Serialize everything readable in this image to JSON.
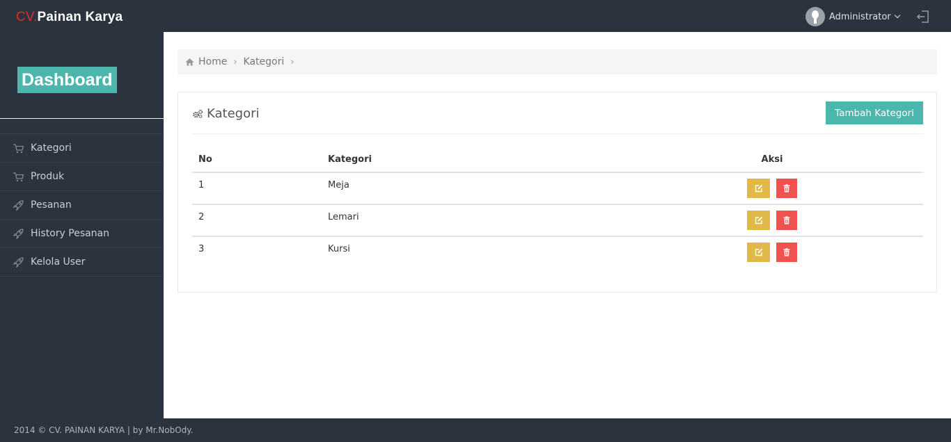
{
  "topbar": {
    "brand_prefix": "CV.",
    "brand_name": "Painan Karya",
    "user_name": "Administrator"
  },
  "sidebar": {
    "dashboard_label": "Dashboard",
    "items": [
      {
        "label": "Kategori",
        "icon": "cart-icon"
      },
      {
        "label": "Produk",
        "icon": "cart-icon"
      },
      {
        "label": "Pesanan",
        "icon": "rocket-icon"
      },
      {
        "label": "History Pesanan",
        "icon": "rocket-icon"
      },
      {
        "label": "Kelola User",
        "icon": "rocket-icon"
      }
    ]
  },
  "breadcrumb": {
    "home": "Home",
    "current": "Kategori"
  },
  "panel": {
    "title": "Kategori",
    "add_button": "Tambah Kategori",
    "columns": [
      "No",
      "Kategori",
      "Aksi"
    ],
    "rows": [
      {
        "no": "1",
        "kategori": "Meja"
      },
      {
        "no": "2",
        "kategori": "Lemari"
      },
      {
        "no": "3",
        "kategori": "Kursi"
      }
    ]
  },
  "footer": {
    "text": "2014 © CV. PAINAN KARYA | by Mr.NobOdy."
  },
  "colors": {
    "navbar": "#2b333e",
    "accent": "#4db6ac",
    "edit": "#e0b948",
    "delete": "#ef5350"
  }
}
